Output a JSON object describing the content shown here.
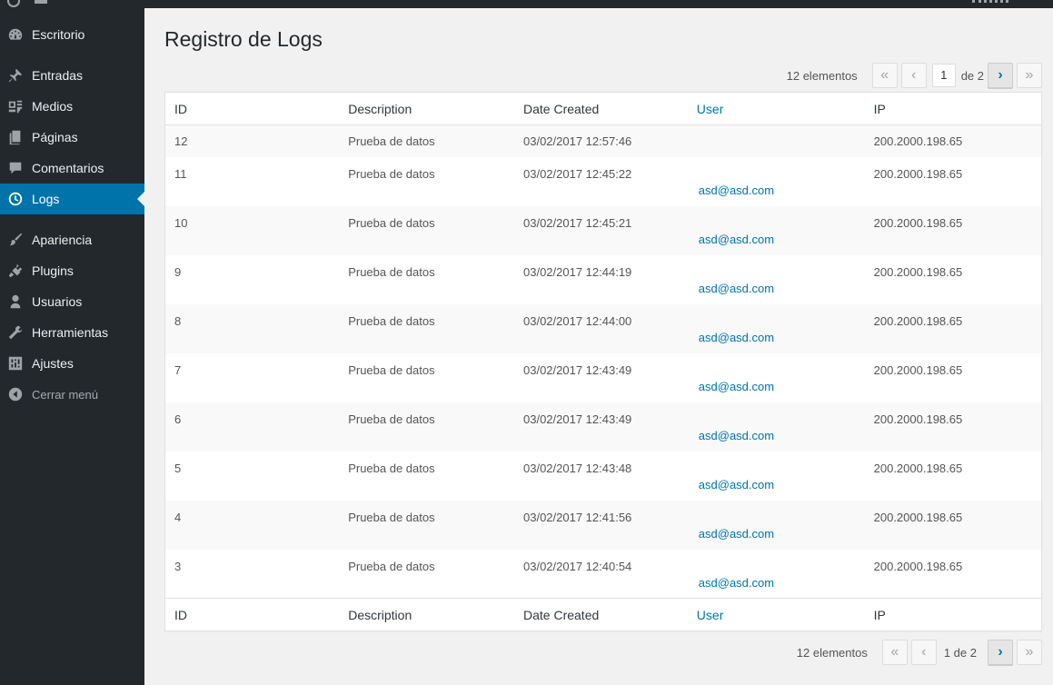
{
  "sidebar": {
    "items": [
      {
        "label": "Escritorio",
        "icon": "dashboard-icon"
      },
      {
        "label": "Entradas",
        "icon": "pin-icon"
      },
      {
        "label": "Medios",
        "icon": "media-icon"
      },
      {
        "label": "Páginas",
        "icon": "pages-icon"
      },
      {
        "label": "Comentarios",
        "icon": "comments-icon"
      },
      {
        "label": "Logs",
        "icon": "clock-icon"
      },
      {
        "label": "Apariencia",
        "icon": "brush-icon"
      },
      {
        "label": "Plugins",
        "icon": "plugin-icon"
      },
      {
        "label": "Usuarios",
        "icon": "user-icon"
      },
      {
        "label": "Herramientas",
        "icon": "wrench-icon"
      },
      {
        "label": "Ajustes",
        "icon": "settings-icon"
      },
      {
        "label": "Cerrar menú",
        "icon": "collapse-icon"
      }
    ],
    "active": "Logs"
  },
  "page": {
    "title": "Registro de Logs"
  },
  "pagination": {
    "count": "12 elementos",
    "current_page": "1",
    "of_label": "de 2",
    "bottom_label": "1 de 2",
    "first": "«",
    "prev": "‹",
    "next": "›",
    "last": "»"
  },
  "table": {
    "columns": [
      "ID",
      "Description",
      "Date Created",
      "User",
      "IP"
    ],
    "rows": [
      {
        "id": "12",
        "description": "Prueba de datos",
        "date": "03/02/2017 12:57:46",
        "user": "",
        "ip": "200.2000.198.65"
      },
      {
        "id": "11",
        "description": "Prueba de datos",
        "date": "03/02/2017 12:45:22",
        "user": "asd@asd.com",
        "ip": "200.2000.198.65"
      },
      {
        "id": "10",
        "description": "Prueba de datos",
        "date": "03/02/2017 12:45:21",
        "user": "asd@asd.com",
        "ip": "200.2000.198.65"
      },
      {
        "id": "9",
        "description": "Prueba de datos",
        "date": "03/02/2017 12:44:19",
        "user": "asd@asd.com",
        "ip": "200.2000.198.65"
      },
      {
        "id": "8",
        "description": "Prueba de datos",
        "date": "03/02/2017 12:44:00",
        "user": "asd@asd.com",
        "ip": "200.2000.198.65"
      },
      {
        "id": "7",
        "description": "Prueba de datos",
        "date": "03/02/2017 12:43:49",
        "user": "asd@asd.com",
        "ip": "200.2000.198.65"
      },
      {
        "id": "6",
        "description": "Prueba de datos",
        "date": "03/02/2017 12:43:49",
        "user": "asd@asd.com",
        "ip": "200.2000.198.65"
      },
      {
        "id": "5",
        "description": "Prueba de datos",
        "date": "03/02/2017 12:43:48",
        "user": "asd@asd.com",
        "ip": "200.2000.198.65"
      },
      {
        "id": "4",
        "description": "Prueba de datos",
        "date": "03/02/2017 12:41:56",
        "user": "asd@asd.com",
        "ip": "200.2000.198.65"
      },
      {
        "id": "3",
        "description": "Prueba de datos",
        "date": "03/02/2017 12:40:54",
        "user": "asd@asd.com",
        "ip": "200.2000.198.65"
      }
    ]
  },
  "colors": {
    "sidebar_bg": "#23282d",
    "accent": "#0073aa",
    "page_bg": "#f1f1f1"
  }
}
